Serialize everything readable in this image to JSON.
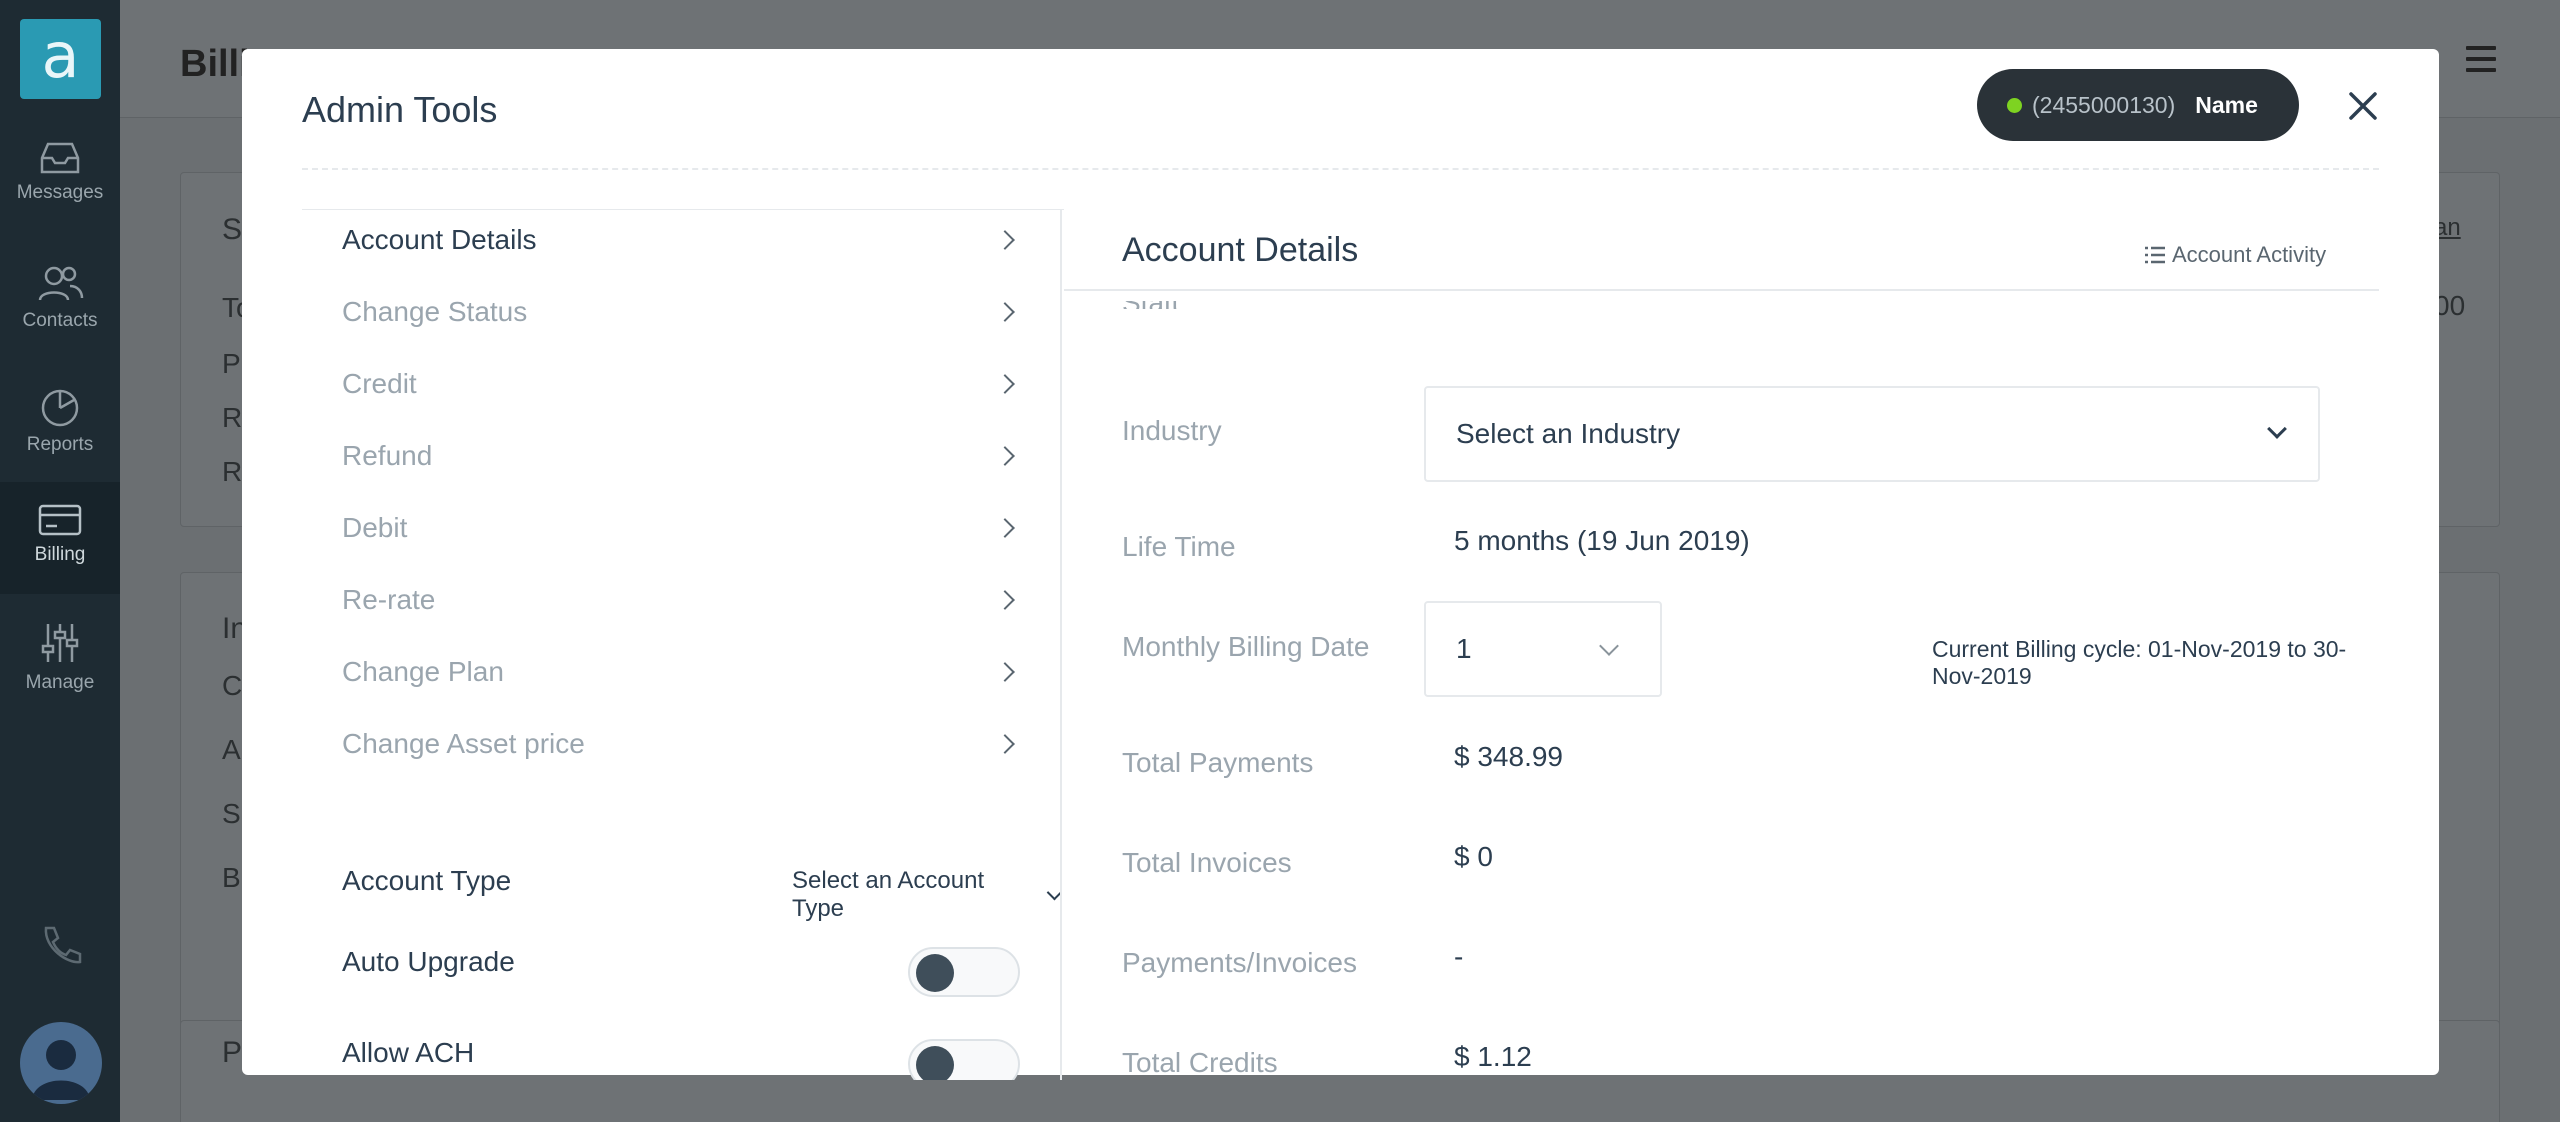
{
  "background": {
    "logo_letter": "a",
    "nav": [
      {
        "label": "Messages"
      },
      {
        "label": "Contacts"
      },
      {
        "label": "Reports"
      },
      {
        "label": "Billing"
      },
      {
        "label": "Manage"
      }
    ],
    "page_title_partial": "Billi",
    "left_edge_letters": [
      "S",
      "To",
      "P",
      "R",
      "R",
      "In",
      "C",
      "A",
      "S",
      "B",
      "P"
    ],
    "right_edge_texts": [
      "an",
      "00"
    ]
  },
  "modal": {
    "title": "Admin Tools",
    "account": {
      "number": "(2455000130)",
      "name": "Name"
    },
    "menu": [
      {
        "label": "Account Details"
      },
      {
        "label": "Change Status"
      },
      {
        "label": "Credit"
      },
      {
        "label": "Refund"
      },
      {
        "label": "Debit"
      },
      {
        "label": "Re-rate"
      },
      {
        "label": "Change Plan"
      },
      {
        "label": "Change Asset price"
      }
    ],
    "account_type": {
      "label": "Account Type",
      "value": "Select an Account Type"
    },
    "auto_upgrade": {
      "label": "Auto Upgrade",
      "on": false
    },
    "allow_ach": {
      "label": "Allow ACH",
      "on": false
    },
    "panel": {
      "title": "Account Details",
      "activity_link": "Account Activity",
      "cut_label": "Status",
      "industry": {
        "label": "Industry",
        "value": "Select an Industry"
      },
      "lifetime": {
        "label": "Life Time",
        "value": "5 months (19 Jun 2019)"
      },
      "billing_date": {
        "label": "Monthly Billing Date",
        "value": "1",
        "cycle": "Current Billing cycle: 01-Nov-2019 to 30-Nov-2019"
      },
      "total_payments": {
        "label": "Total Payments",
        "value": "$ 348.99"
      },
      "total_invoices": {
        "label": "Total Invoices",
        "value": "$ 0"
      },
      "payments_invoices": {
        "label": "Payments/Invoices",
        "value": "-"
      },
      "total_credits": {
        "label": "Total Credits",
        "value": "$ 1.12"
      }
    }
  }
}
